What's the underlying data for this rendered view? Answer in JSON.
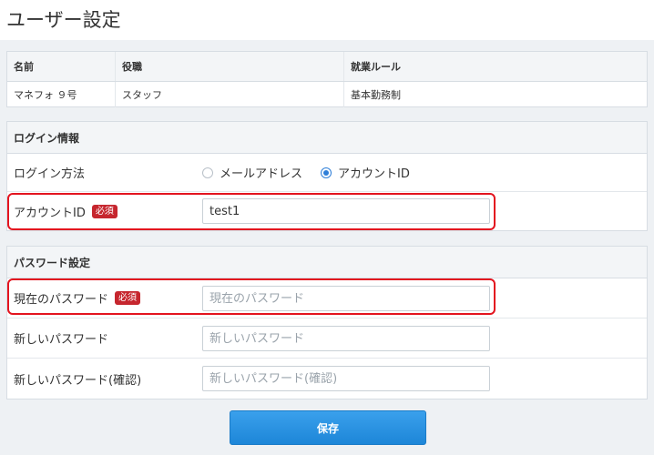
{
  "page": {
    "title": "ユーザー設定"
  },
  "user_info": {
    "headers": [
      "名前",
      "役職",
      "就業ルール"
    ],
    "row": [
      "マネフォ ９号",
      "スタッフ",
      "基本勤務制"
    ]
  },
  "login": {
    "section_title": "ログイン情報",
    "method_label": "ログイン方法",
    "options": [
      "メールアドレス",
      "アカウントID"
    ],
    "selected_option": "アカウントID",
    "account_id_label": "アカウントID",
    "required_badge": "必須",
    "account_id_value": "test1"
  },
  "password": {
    "section_title": "パスワード設定",
    "current_label": "現在のパスワード",
    "current_placeholder": "現在のパスワード",
    "new_label": "新しいパスワード",
    "new_placeholder": "新しいパスワード",
    "confirm_label": "新しいパスワード(確認)",
    "confirm_placeholder": "新しいパスワード(確認)",
    "required_badge": "必須"
  },
  "actions": {
    "save_label": "保存"
  },
  "colors": {
    "accent": "#2f7fd8",
    "required": "#c6262e",
    "highlight": "#e3141f",
    "button": "#1d86d8"
  }
}
